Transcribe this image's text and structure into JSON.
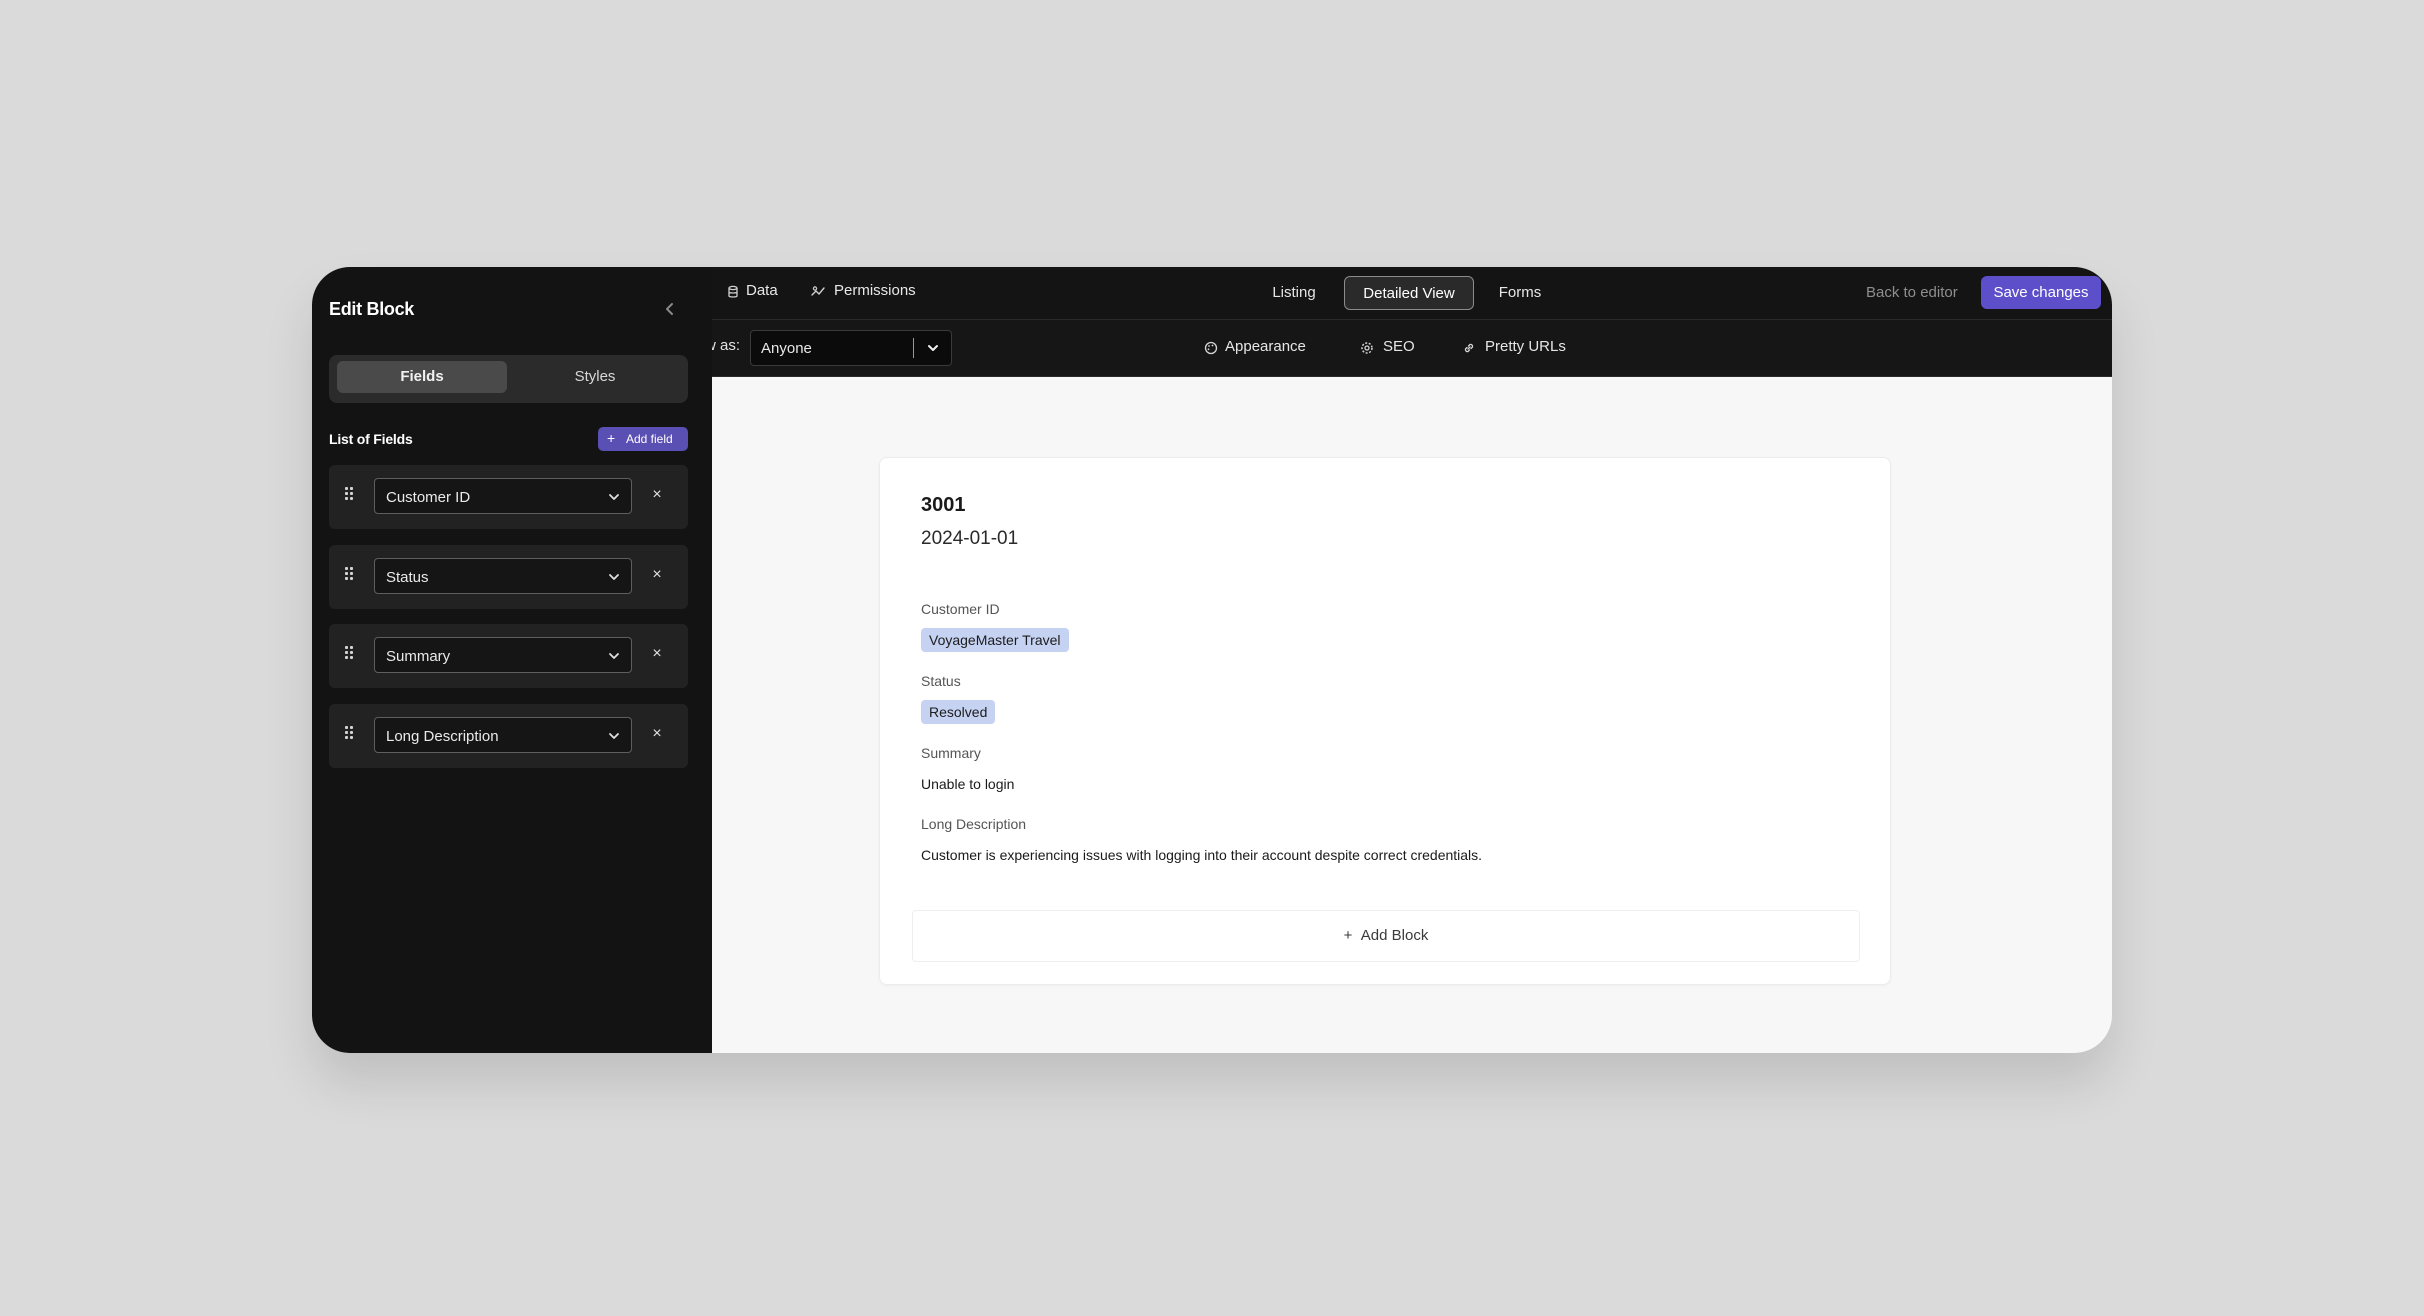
{
  "sidebar": {
    "title": "Edit Block",
    "segments": [
      "Fields",
      "Styles"
    ],
    "list_title": "List of Fields",
    "add_field_label": "Add field",
    "fields": [
      "Customer ID",
      "Status",
      "Summary",
      "Long Description"
    ],
    "remove_glyph": "×"
  },
  "topbar": {
    "data_label": "Data",
    "permissions_label": "Permissions",
    "tabs": [
      "Listing",
      "Detailed View",
      "Forms"
    ],
    "active_tab": "Detailed View",
    "back_label": "Back to editor",
    "save_label": "Save changes",
    "save_color": "#5d4ec9"
  },
  "subbar": {
    "view_as_label": "w as:",
    "view_as_value": "Anyone",
    "appearance_label": "Appearance",
    "seo_label": "SEO",
    "pretty_urls_label": "Pretty URLs"
  },
  "record": {
    "id": "3001",
    "date": "2024-01-01",
    "fields": [
      {
        "label": "Customer ID",
        "value": "VoyageMaster Travel",
        "chip": true
      },
      {
        "label": "Status",
        "value": "Resolved",
        "chip": true
      },
      {
        "label": "Summary",
        "value": "Unable to login",
        "chip": false
      },
      {
        "label": "Long Description",
        "value": "Customer is experiencing issues with logging into their account despite correct credentials.",
        "chip": false
      }
    ],
    "chip_color": "#c5d2f2"
  },
  "add_block_label": "Add Block",
  "icons": [
    "chevron-left-icon",
    "drag-handle-icon",
    "chevron-down-icon",
    "close-icon",
    "database-icon",
    "permissions-icon",
    "palette-icon",
    "gear-icon",
    "link-icon",
    "plus-icon"
  ]
}
